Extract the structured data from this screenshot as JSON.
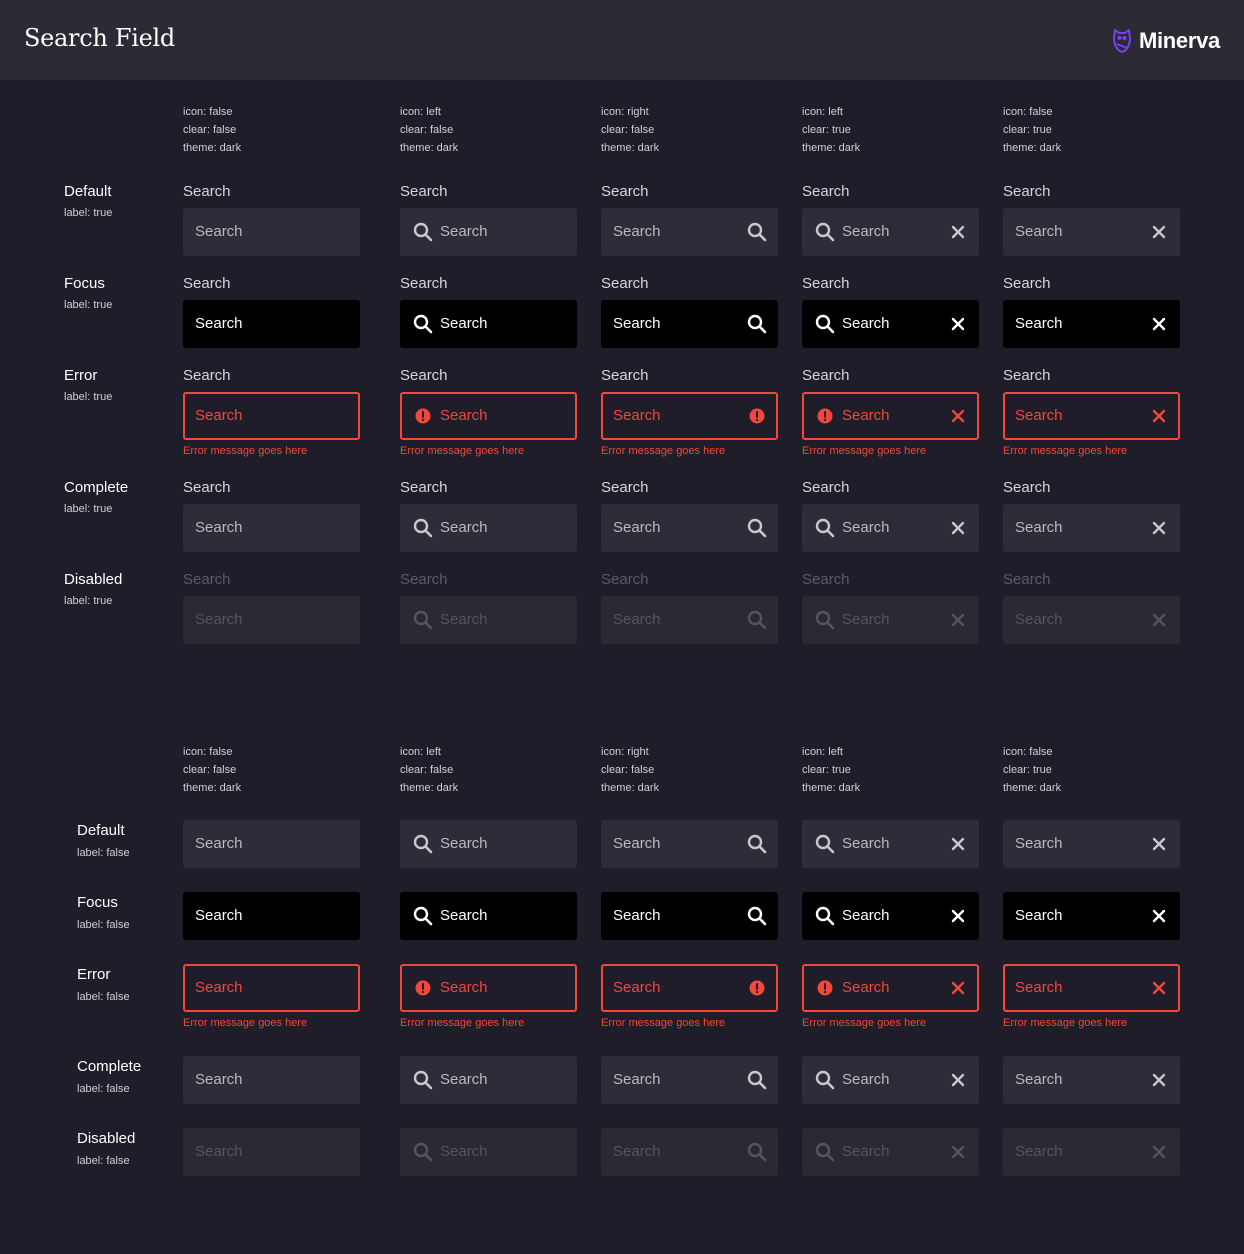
{
  "header": {
    "title": "Search Field",
    "brand": "Minerva"
  },
  "colors": {
    "error": "#f2473a",
    "brand": "#7b3ff2",
    "field_bg": "#2d2c38",
    "focus_bg": "#000000"
  },
  "columns": [
    {
      "icon": "icon: false",
      "clear": "clear: false",
      "theme": "theme: dark",
      "icon_pos": "none",
      "clear_btn": false
    },
    {
      "icon": "icon: left",
      "clear": "clear: false",
      "theme": "theme: dark",
      "icon_pos": "left",
      "clear_btn": false
    },
    {
      "icon": "icon: right",
      "clear": "clear: false",
      "theme": "theme: dark",
      "icon_pos": "right",
      "clear_btn": false
    },
    {
      "icon": "icon: left",
      "clear": "clear: true",
      "theme": "theme: dark",
      "icon_pos": "left",
      "clear_btn": true
    },
    {
      "icon": "icon: false",
      "clear": "clear: true",
      "theme": "theme: dark",
      "icon_pos": "none",
      "clear_btn": true
    }
  ],
  "field": {
    "label": "Search",
    "placeholder": "Search",
    "error_message": "Error message goes here"
  },
  "sections": [
    {
      "rows": [
        {
          "name": "Default",
          "sub": "label: true",
          "state": "default"
        },
        {
          "name": "Focus",
          "sub": "label: true",
          "state": "focus"
        },
        {
          "name": "Error",
          "sub": "label: true",
          "state": "error"
        },
        {
          "name": "Complete",
          "sub": "label: true",
          "state": "complete"
        },
        {
          "name": "Disabled",
          "sub": "label: true",
          "state": "disabled"
        }
      ]
    },
    {
      "rows": [
        {
          "name": "Default",
          "sub": "label: false",
          "state": "default"
        },
        {
          "name": "Focus",
          "sub": "label: false",
          "state": "focus"
        },
        {
          "name": "Error",
          "sub": "label: false",
          "state": "error"
        },
        {
          "name": "Complete",
          "sub": "label: false",
          "state": "complete"
        },
        {
          "name": "Disabled",
          "sub": "label: false",
          "state": "disabled"
        }
      ]
    }
  ]
}
